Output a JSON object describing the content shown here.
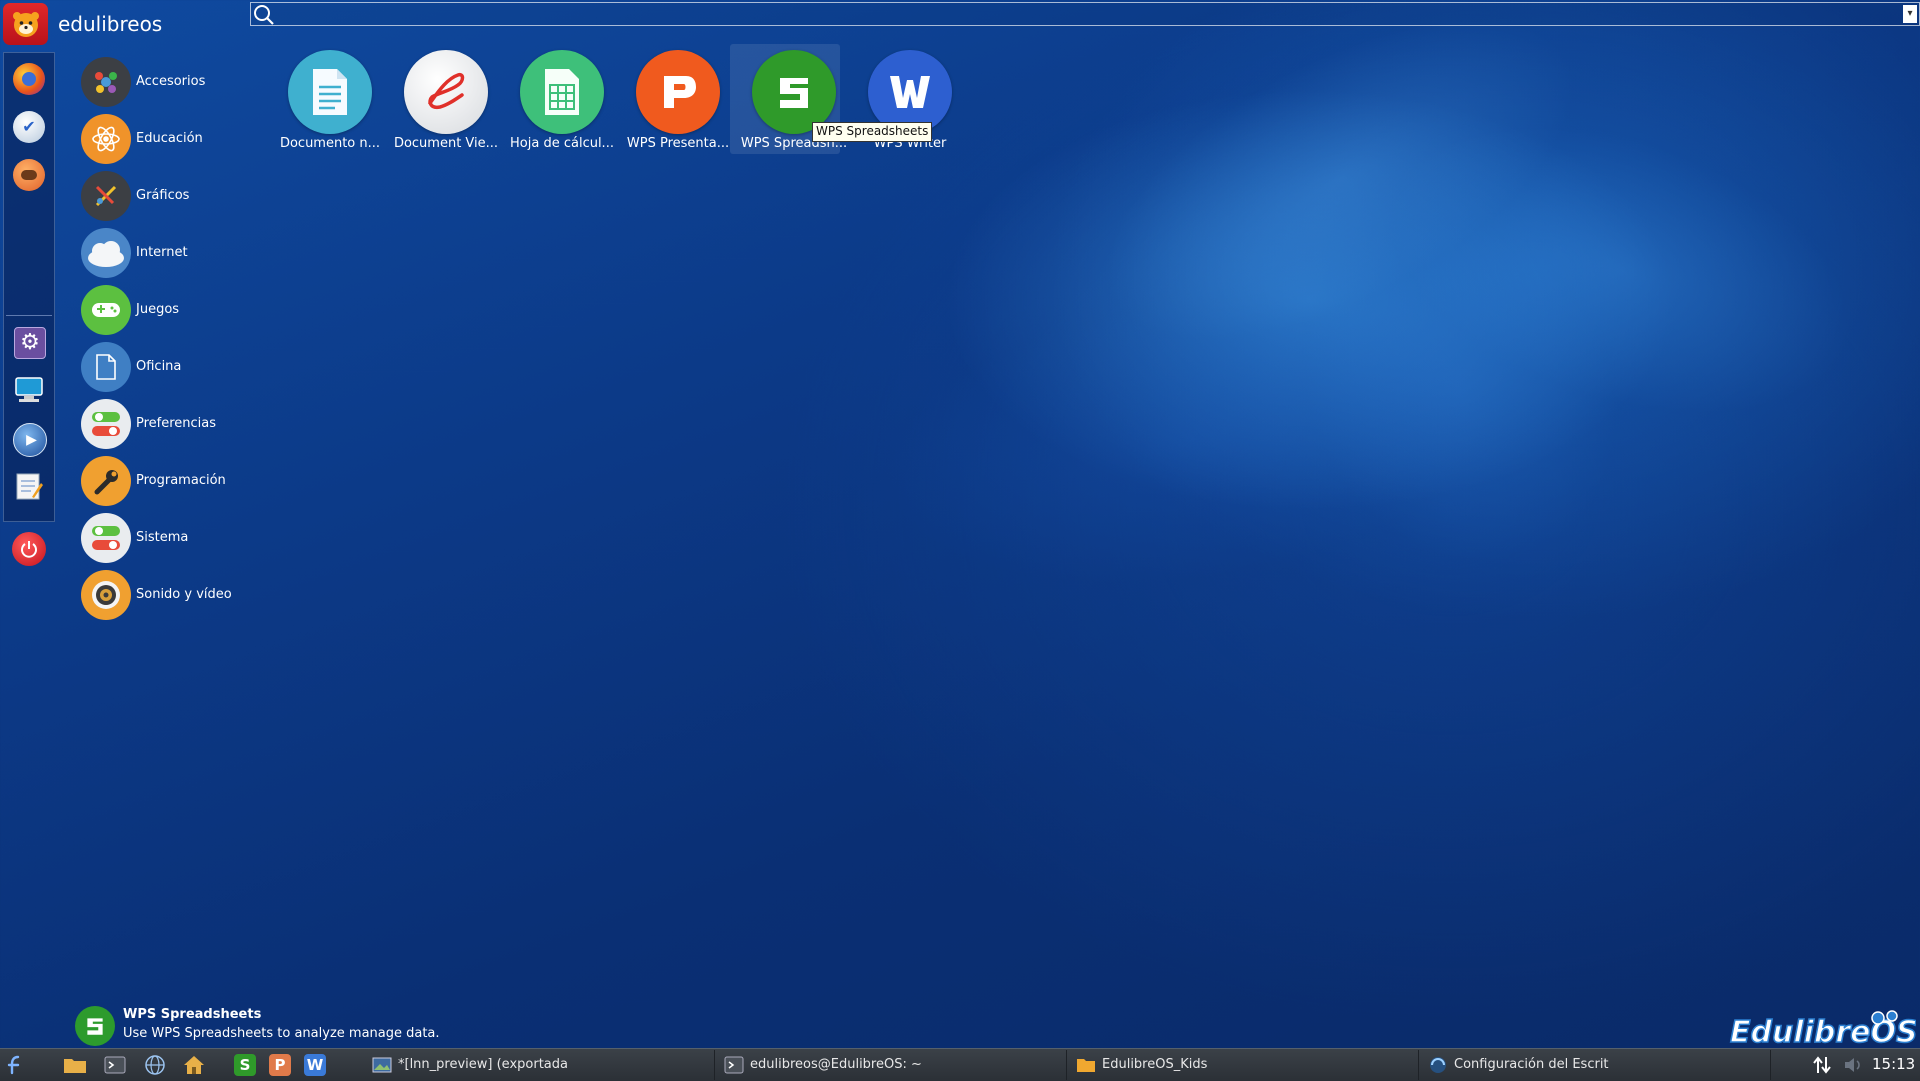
{
  "header": {
    "user_name": "edulibreos"
  },
  "search": {
    "placeholder": "",
    "value": ""
  },
  "categories": [
    {
      "label": "Accesorios"
    },
    {
      "label": "Educación"
    },
    {
      "label": "Gráficos"
    },
    {
      "label": "Internet"
    },
    {
      "label": "Juegos"
    },
    {
      "label": "Oficina"
    },
    {
      "label": "Preferencias"
    },
    {
      "label": "Programación"
    },
    {
      "label": "Sistema"
    },
    {
      "label": "Sonido y vídeo"
    }
  ],
  "apps": [
    {
      "label": "Documento n...",
      "color": "#3fb0cf"
    },
    {
      "label": "Document Vie...",
      "color": "#eeeeee"
    },
    {
      "label": "Hoja de cálcul...",
      "color": "#3ec07a"
    },
    {
      "label": "WPS Presenta...",
      "color": "#f05a1e"
    },
    {
      "label": "WPS Spreadsh...",
      "color": "#2f9a2a"
    },
    {
      "label": "WPS Writer",
      "color": "#2d5fd0"
    }
  ],
  "tooltip": "WPS Spreadsheets",
  "description": {
    "title": "WPS Spreadsheets",
    "text": "Use WPS Spreadsheets to analyze manage data."
  },
  "taskbar": {
    "tasks": [
      {
        "label": "*[lnn_preview] (exportada"
      },
      {
        "label": "edulibreos@EdulibreOS: ~"
      },
      {
        "label": "EdulibreOS_Kids"
      },
      {
        "label": "Configuración del Escrit"
      }
    ],
    "clock": "15:13"
  },
  "brand": {
    "logo_text": "EdulibreOS"
  }
}
